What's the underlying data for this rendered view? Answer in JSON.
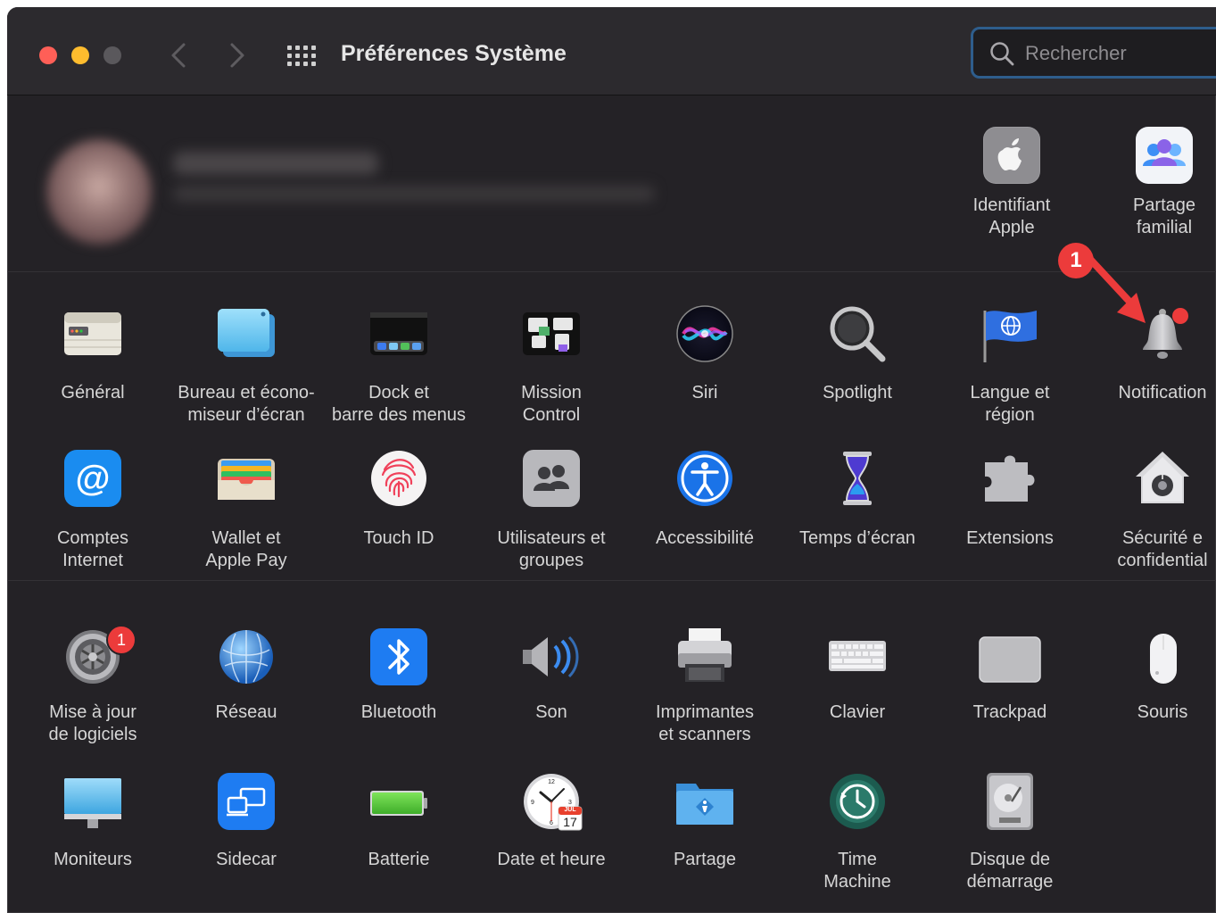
{
  "window": {
    "title": "Préférences Système",
    "search_placeholder": "Rechercher"
  },
  "account_panes": [
    {
      "label": "Identifiant\nApple",
      "icon": "apple-id-icon"
    },
    {
      "label": "Partage\nfamilial",
      "icon": "family-sharing-icon"
    }
  ],
  "row1": [
    {
      "label": "Général",
      "icon": "general-icon"
    },
    {
      "label": "Bureau et écono-\nmiseur d’écran",
      "icon": "desktop-screensaver-icon"
    },
    {
      "label": "Dock et\nbarre des menus",
      "icon": "dock-icon"
    },
    {
      "label": "Mission\nControl",
      "icon": "mission-control-icon"
    },
    {
      "label": "Siri",
      "icon": "siri-icon"
    },
    {
      "label": "Spotlight",
      "icon": "spotlight-icon"
    },
    {
      "label": "Langue et\nrégion",
      "icon": "language-region-icon"
    },
    {
      "label": "Notification",
      "icon": "notifications-icon"
    }
  ],
  "row2": [
    {
      "label": "Comptes\nInternet",
      "icon": "internet-accounts-icon"
    },
    {
      "label": "Wallet et\nApple Pay",
      "icon": "wallet-icon"
    },
    {
      "label": "Touch ID",
      "icon": "touch-id-icon"
    },
    {
      "label": "Utilisateurs et\ngroupes",
      "icon": "users-groups-icon"
    },
    {
      "label": "Accessibilité",
      "icon": "accessibility-icon"
    },
    {
      "label": "Temps d’écran",
      "icon": "screen-time-icon"
    },
    {
      "label": "Extensions",
      "icon": "extensions-icon"
    },
    {
      "label": "Sécurité e\nconfidential",
      "icon": "security-icon"
    }
  ],
  "row3": [
    {
      "label": "Mise à jour\nde logiciels",
      "icon": "software-update-icon",
      "badge": "1"
    },
    {
      "label": "Réseau",
      "icon": "network-icon"
    },
    {
      "label": "Bluetooth",
      "icon": "bluetooth-icon"
    },
    {
      "label": "Son",
      "icon": "sound-icon"
    },
    {
      "label": "Imprimantes\net scanners",
      "icon": "printer-icon"
    },
    {
      "label": "Clavier",
      "icon": "keyboard-icon"
    },
    {
      "label": "Trackpad",
      "icon": "trackpad-icon"
    },
    {
      "label": "Souris",
      "icon": "mouse-icon"
    }
  ],
  "row4": [
    {
      "label": "Moniteurs",
      "icon": "displays-icon"
    },
    {
      "label": "Sidecar",
      "icon": "sidecar-icon"
    },
    {
      "label": "Batterie",
      "icon": "battery-icon"
    },
    {
      "label": "Date et heure",
      "icon": "date-time-icon",
      "calendar_month": "JUL",
      "calendar_day": "17"
    },
    {
      "label": "Partage",
      "icon": "sharing-icon"
    },
    {
      "label": "Time\nMachine",
      "icon": "time-machine-icon"
    },
    {
      "label": "Disque de\ndémarrage",
      "icon": "startup-disk-icon"
    }
  ],
  "annotation": {
    "step_number": "1"
  },
  "colors": {
    "accent_red": "#ec3b3b",
    "window_bg": "#242226",
    "label": "#d6d6d6"
  }
}
